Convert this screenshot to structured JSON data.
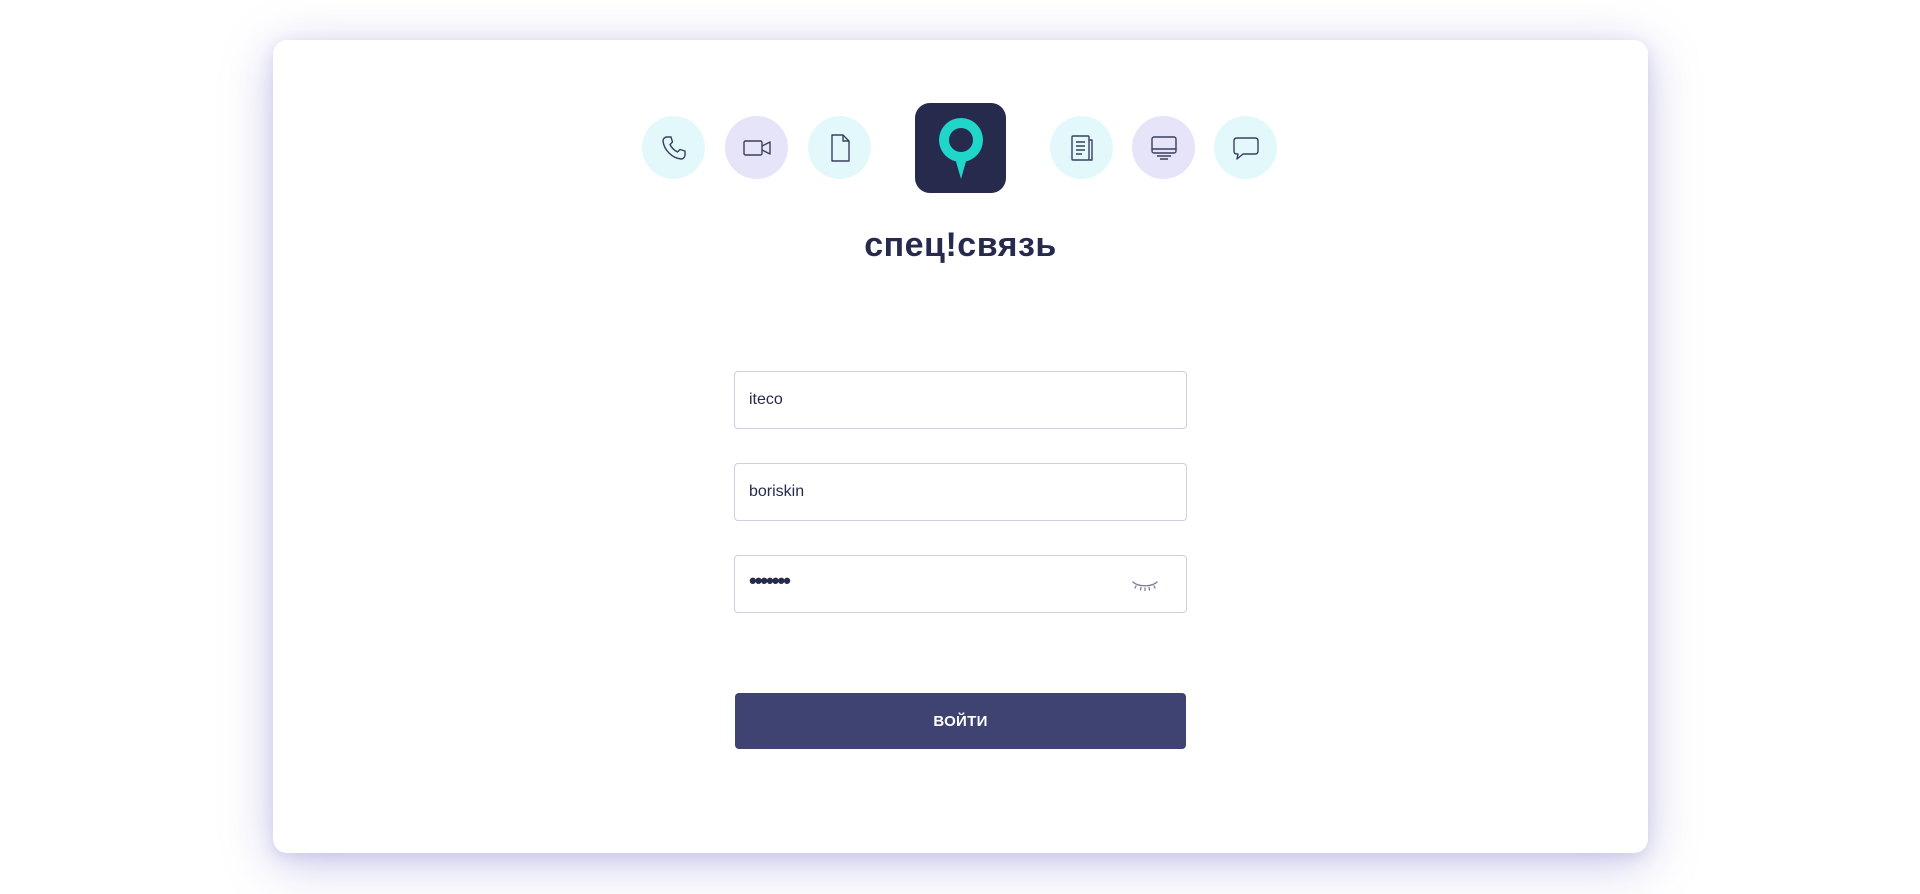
{
  "header": {
    "left_icons": [
      {
        "name": "phone-icon",
        "bg": "#e3f8fb"
      },
      {
        "name": "video-camera-icon",
        "bg": "#e6e4f8"
      },
      {
        "name": "document-icon",
        "bg": "#e3f8fb"
      }
    ],
    "right_icons": [
      {
        "name": "notes-icon",
        "bg": "#e3f8fb"
      },
      {
        "name": "monitor-icon",
        "bg": "#e6e4f8"
      },
      {
        "name": "chat-bubble-icon",
        "bg": "#e3f8fb"
      }
    ],
    "logo_icon": "pin-logo-icon",
    "brand_name": "спец!связь"
  },
  "form": {
    "domain_value": "iteco",
    "username_value": "boriskin",
    "password_masked": "•••••••",
    "password_toggle_icon": "eye-closed-icon",
    "submit_label": "ВОЙТИ"
  },
  "colors": {
    "brand_dark": "#262a4d",
    "accent_teal": "#1fd6c8",
    "button": "#3f4372",
    "icon_bg_cyan": "#e3f8fb",
    "icon_bg_lavender": "#e6e4f8"
  }
}
